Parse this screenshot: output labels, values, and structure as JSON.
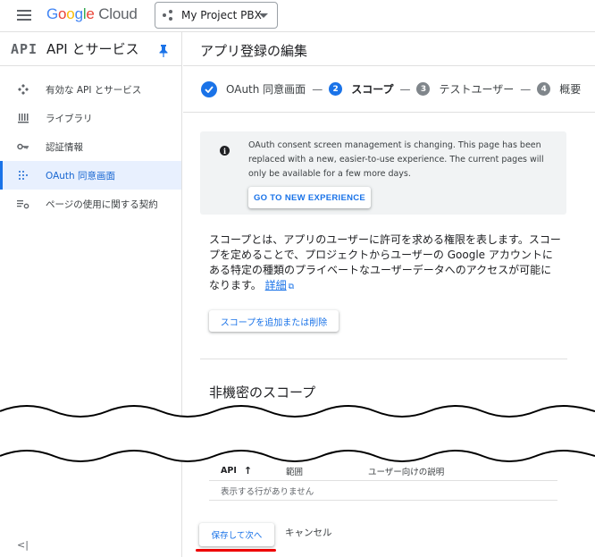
{
  "header": {
    "logo_letters": [
      "G",
      "o",
      "o",
      "g",
      "l",
      "e"
    ],
    "logo_suffix": "Cloud",
    "project_name": "My Project PBX"
  },
  "sidebar": {
    "api_badge": "API",
    "title": "API とサービス",
    "items": [
      {
        "label": "有効な API とサービス",
        "icon": "diamond-icon"
      },
      {
        "label": "ライブラリ",
        "icon": "library-icon"
      },
      {
        "label": "認証情報",
        "icon": "key-icon"
      },
      {
        "label": "OAuth 同意画面",
        "icon": "oauth-icon",
        "active": true
      },
      {
        "label": "ページの使用に関する契約",
        "icon": "settings-list-icon"
      }
    ],
    "collapse_label": "<|"
  },
  "main": {
    "title": "アプリ登録の編集",
    "stepper": {
      "steps": [
        {
          "number": "",
          "label": "OAuth 同意画面",
          "state": "done"
        },
        {
          "number": "2",
          "label": "スコープ",
          "state": "current"
        },
        {
          "number": "3",
          "label": "テストユーザー",
          "state": "todo"
        },
        {
          "number": "4",
          "label": "概要",
          "state": "todo"
        }
      ],
      "separator": "—"
    },
    "banner": {
      "text": "OAuth consent screen management is changing. This page has been replaced with a new, easier-to-use experience. The current pages will only be available for a few more days.",
      "button": "GO TO NEW EXPERIENCE"
    },
    "description": "スコープとは、アプリのユーザーに許可を求める権限を表します。スコープを定めることで、プロジェクトからユーザーの Google アカウントにある特定の種類のプライベートなユーザーデータへのアクセスが可能になります。",
    "learn_more": "詳細",
    "add_scope_button": "スコープを追加または削除",
    "section_title": "非機密のスコープ",
    "table": {
      "columns": [
        "API",
        "範囲",
        "ユーザー向けの説明"
      ],
      "empty_message": "表示する行がありません"
    },
    "footer": {
      "save_button": "保存して次へ",
      "cancel_button": "キャンセル"
    }
  },
  "colors": {
    "accent": "#1a73e8",
    "highlight": "#e00000"
  }
}
